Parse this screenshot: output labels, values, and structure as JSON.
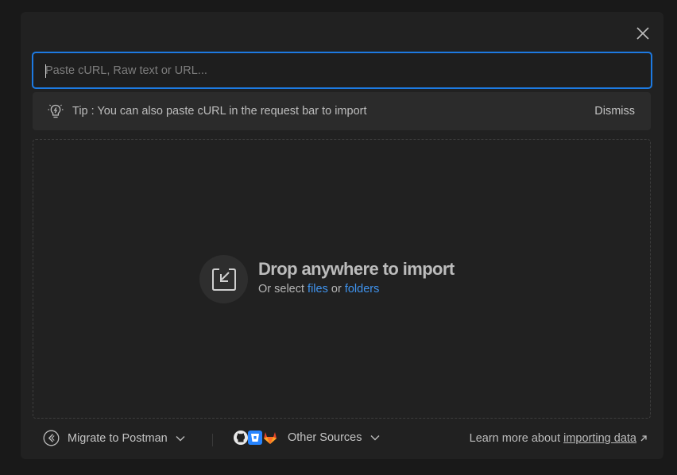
{
  "input": {
    "placeholder": "Paste cURL, Raw text or URL..."
  },
  "tip": {
    "text": "Tip : You can also paste cURL in the request bar to import",
    "dismiss_label": "Dismiss"
  },
  "dropzone": {
    "title": "Drop anywhere to import",
    "subtitle_prefix": "Or select",
    "files_link": "files",
    "or_text": "or",
    "folders_link": "folders"
  },
  "footer": {
    "migrate_label": "Migrate to Postman",
    "other_sources_label": "Other Sources",
    "learn_prefix": "Learn more about",
    "learn_link": "importing data"
  },
  "colors": {
    "accent": "#1d7ae2",
    "link": "#3f93ee",
    "background": "#212121"
  },
  "icons": [
    "close-icon",
    "lightbulb-icon",
    "import-icon",
    "migrate-icon",
    "github-icon",
    "bitbucket-icon",
    "gitlab-icon",
    "chevron-down-icon",
    "external-arrow-icon"
  ]
}
